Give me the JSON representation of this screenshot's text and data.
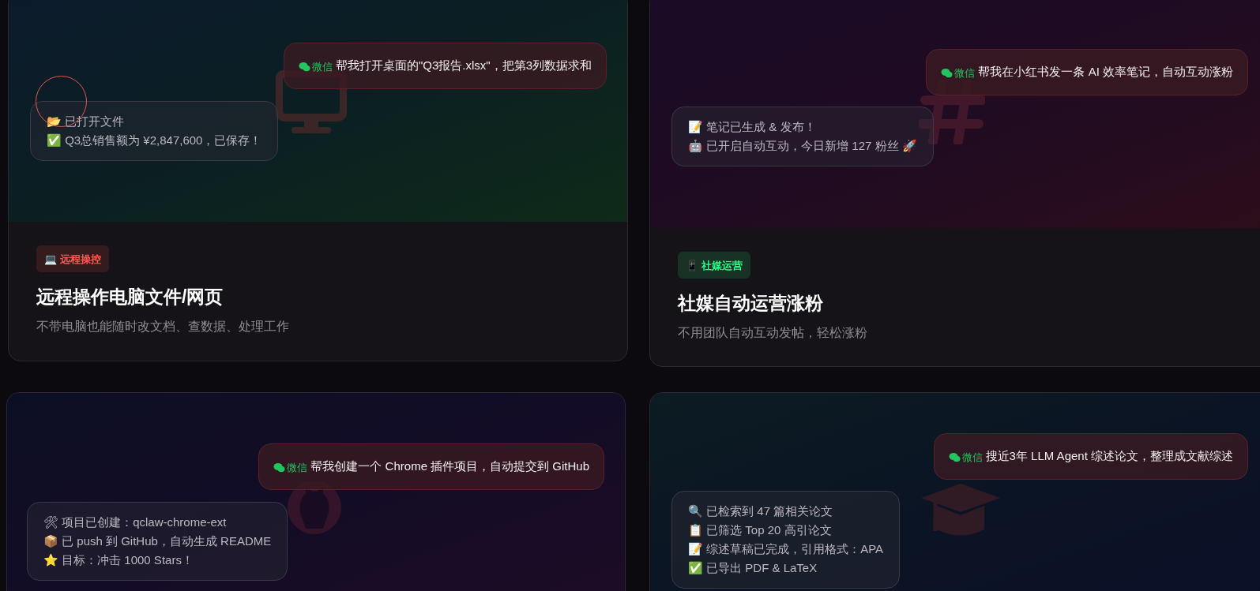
{
  "cards": [
    {
      "message": {
        "app": "微信",
        "text": "帮我打开桌面的\"Q3报告.xlsx\"，把第3列数据求和"
      },
      "reply": [
        "📂 已打开文件",
        "✅ Q3总销售额为 ¥2,847,600，已保存！"
      ],
      "tag": {
        "text": "💻 远程操控",
        "color": "#ff5a4f"
      },
      "title": "远程操作电脑文件/网页",
      "subtitle": "不带电脑也能随时改文档、查数据、处理工作"
    },
    {
      "message": {
        "app": "微信",
        "text": "帮我在小红书发一条 AI 效率笔记，自动互动涨粉"
      },
      "reply": [
        "📝 笔记已生成 & 发布！",
        "🤖 已开启自动互动，今日新增 127 粉丝 🚀"
      ],
      "tag": {
        "text": "📱 社媒运营",
        "color": "#2bff88"
      },
      "title": "社媒自动运营涨粉",
      "subtitle": "不用团队自动互动发帖，轻松涨粉"
    },
    {
      "message": {
        "app": "微信",
        "text": "帮我创建一个 Chrome 插件项目，自动提交到 GitHub"
      },
      "reply": [
        "🛠 项目已创建：qclaw-chrome-ext",
        "📦 已 push 到 GitHub，自动生成 README",
        "⭐ 目标：冲击 1000 Stars！"
      ]
    },
    {
      "message": {
        "app": "微信",
        "text": "搜近3年 LLM Agent 综述论文，整理成文献综述"
      },
      "reply": [
        "🔍 已检索到 47 篇相关论文",
        "📋 已筛选 Top 20 高引论文",
        "📝 综述草稿已完成，引用格式：APA",
        "✅ 已导出 PDF & LaTeX"
      ]
    }
  ]
}
